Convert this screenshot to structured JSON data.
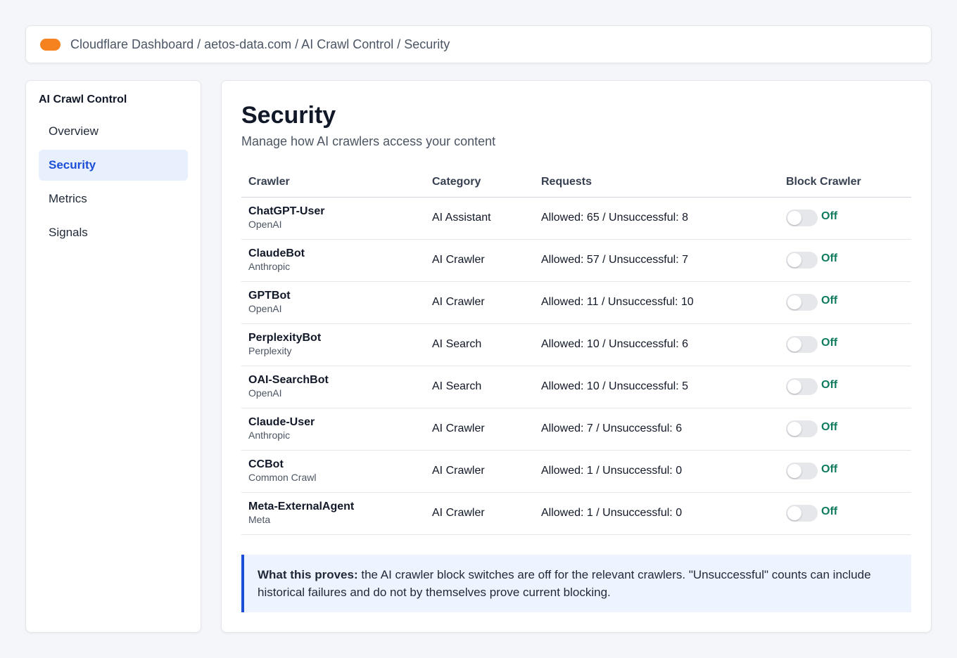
{
  "breadcrumb": "Cloudflare Dashboard / aetos-data.com / AI Crawl Control / Security",
  "colors": {
    "brand": "#f6821f",
    "accent": "#1d4ed8",
    "toggle_off_text": "#0f7b5f"
  },
  "sidebar": {
    "title": "AI Crawl Control",
    "items": [
      {
        "label": "Overview",
        "active": false
      },
      {
        "label": "Security",
        "active": true
      },
      {
        "label": "Metrics",
        "active": false
      },
      {
        "label": "Signals",
        "active": false
      }
    ]
  },
  "main": {
    "title": "Security",
    "subtitle": "Manage how AI crawlers access your content",
    "table": {
      "headers": [
        "Crawler",
        "Category",
        "Requests",
        "Block Crawler"
      ],
      "rows": [
        {
          "name": "ChatGPT-User",
          "vendor": "OpenAI",
          "category": "AI Assistant",
          "requests": "Allowed: 65 / Unsuccessful: 8",
          "toggle": "Off"
        },
        {
          "name": "ClaudeBot",
          "vendor": "Anthropic",
          "category": "AI Crawler",
          "requests": "Allowed: 57 / Unsuccessful: 7",
          "toggle": "Off"
        },
        {
          "name": "GPTBot",
          "vendor": "OpenAI",
          "category": "AI Crawler",
          "requests": "Allowed: 11 / Unsuccessful: 10",
          "toggle": "Off"
        },
        {
          "name": "PerplexityBot",
          "vendor": "Perplexity",
          "category": "AI Search",
          "requests": "Allowed: 10 / Unsuccessful: 6",
          "toggle": "Off"
        },
        {
          "name": "OAI-SearchBot",
          "vendor": "OpenAI",
          "category": "AI Search",
          "requests": "Allowed: 10 / Unsuccessful: 5",
          "toggle": "Off"
        },
        {
          "name": "Claude-User",
          "vendor": "Anthropic",
          "category": "AI Crawler",
          "requests": "Allowed: 7 / Unsuccessful: 6",
          "toggle": "Off"
        },
        {
          "name": "CCBot",
          "vendor": "Common Crawl",
          "category": "AI Crawler",
          "requests": "Allowed: 1 / Unsuccessful: 0",
          "toggle": "Off"
        },
        {
          "name": "Meta-ExternalAgent",
          "vendor": "Meta",
          "category": "AI Crawler",
          "requests": "Allowed: 1 / Unsuccessful: 0",
          "toggle": "Off"
        }
      ]
    },
    "note": {
      "lead": "What this proves:",
      "text": " the AI crawler block switches are off for the relevant crawlers. \"Unsuccessful\" counts can include historical failures and do not by themselves prove current blocking."
    }
  }
}
